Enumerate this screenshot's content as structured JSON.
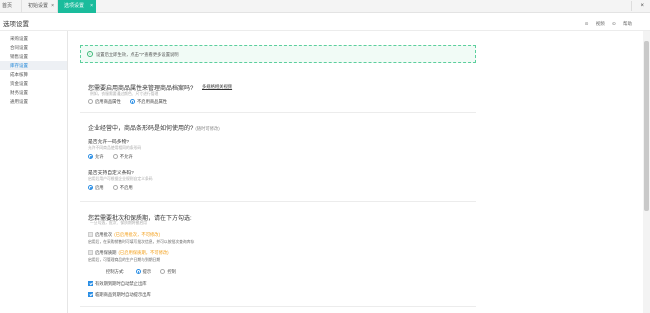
{
  "tabs": {
    "home": "首页",
    "init": "初始设置",
    "active": "选项设置",
    "close_glyph": "×"
  },
  "window": {
    "close_glyph": "×"
  },
  "header": {
    "title": "选项设置",
    "video": "视频",
    "help": "帮助"
  },
  "sidebar": {
    "items": [
      {
        "label": "采购设置",
        "active": false
      },
      {
        "label": "合同设置",
        "active": false
      },
      {
        "label": "销售设置",
        "active": false
      },
      {
        "label": "库存设置",
        "active": true
      },
      {
        "label": "成本核算",
        "active": false
      },
      {
        "label": "资金设置",
        "active": false
      },
      {
        "label": "财务设置",
        "active": false
      },
      {
        "label": "通用设置",
        "active": false
      }
    ]
  },
  "notice": {
    "text": "设置后立即生效，点击“?”查看更多设置说明"
  },
  "section1": {
    "title": "您需要启用商品属性来管理商品档案吗?",
    "link": "多规格相关视频",
    "hint": "例如，衣服需要通过颜色、尺寸进行管理",
    "opt_enable": "启用商品属性",
    "opt_disable": "不启用商品属性"
  },
  "section2": {
    "title": "企业经营中，商品条形码是如何使用的?",
    "note": "(随时可修改)",
    "q1": "是否允许一码多物?",
    "q1_hint": "允许不同商品使用相同的条形码",
    "q1_yes": "允许",
    "q1_no": "不允许",
    "q2": "是否支持自定义条码?",
    "q2_hint": "启用后用户可根据企业规则自定义条码",
    "q2_yes": "启用",
    "q2_no": "不启用"
  },
  "section3": {
    "title": "您若需要批次和保质期，请在下方勾选:",
    "hint": "一旦勾选，批次、保质期将被启用",
    "batch_label": "启用批次",
    "batch_warn": "(已启用批次，不可修改)",
    "batch_hint": "启用后，在采购销售时可填写批次信息，并可以按批次查询库存",
    "shelf_label": "启用保质期",
    "shelf_warn": "(已启用保质期，不可修改)",
    "shelf_hint": "启用后，可管理商品的生产日期与到期日期",
    "control_label": "控制方式:",
    "control_remind": "提示",
    "control_strict": "控制",
    "check1": "有效期到期时自动禁止出库",
    "check2": "临期商品到期时自动提示出库"
  }
}
